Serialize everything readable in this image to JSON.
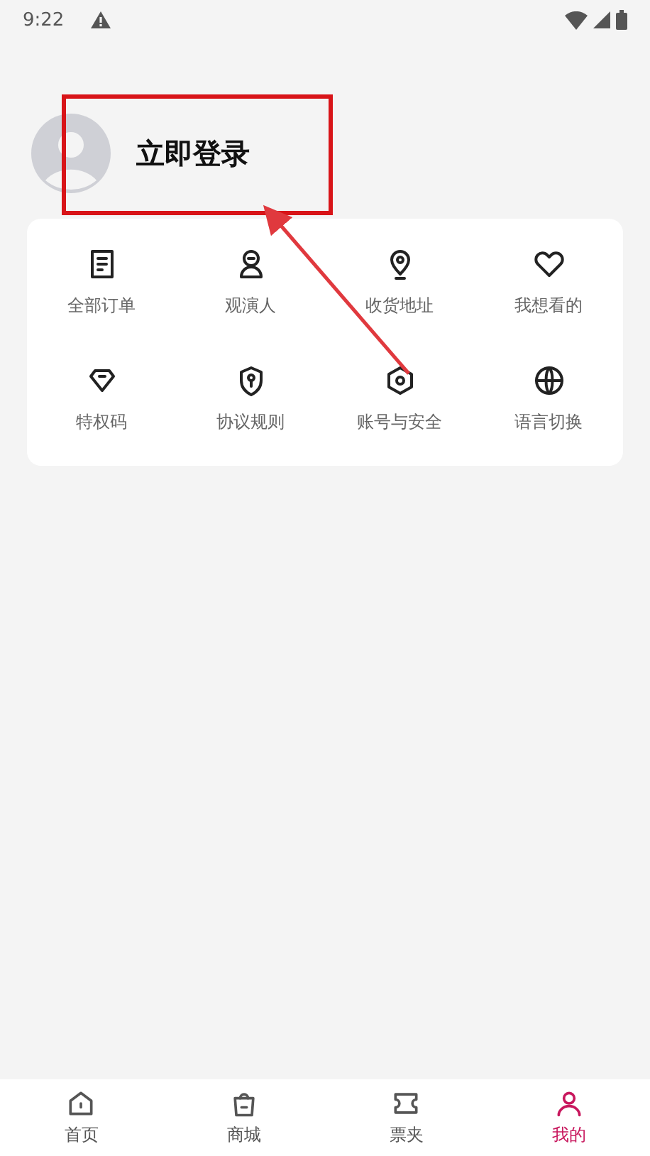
{
  "status_bar": {
    "time": "9:22"
  },
  "profile": {
    "login_label": "立即登录"
  },
  "menu": [
    {
      "label": "全部订单"
    },
    {
      "label": "观演人"
    },
    {
      "label": "收货地址"
    },
    {
      "label": "我想看的"
    },
    {
      "label": "特权码"
    },
    {
      "label": "协议规则"
    },
    {
      "label": "账号与安全"
    },
    {
      "label": "语言切换"
    }
  ],
  "tabs": [
    {
      "label": "首页",
      "selected": false
    },
    {
      "label": "商城",
      "selected": false
    },
    {
      "label": "票夹",
      "selected": false
    },
    {
      "label": "我的",
      "selected": true
    }
  ]
}
